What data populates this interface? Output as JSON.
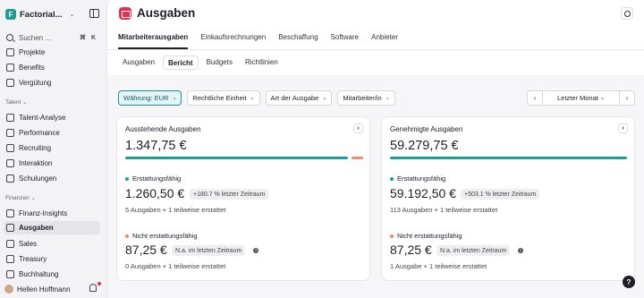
{
  "sidebar": {
    "brand": "Factorial...",
    "search": {
      "placeholder": "Suchen ...",
      "key1": "⌘",
      "key2": "K"
    },
    "items_top": [
      {
        "label": "Projekte",
        "icon": "projects-icon"
      },
      {
        "label": "Benefits",
        "icon": "benefits-icon"
      },
      {
        "label": "Vergütung",
        "icon": "compensation-icon"
      }
    ],
    "section_talent": "Talent",
    "items_talent": [
      {
        "label": "Talent-Analyse",
        "icon": "analytics-icon"
      },
      {
        "label": "Performance",
        "icon": "performance-icon"
      },
      {
        "label": "Recruiting",
        "icon": "recruiting-icon"
      },
      {
        "label": "Interaktion",
        "icon": "engagement-icon"
      },
      {
        "label": "Schulungen",
        "icon": "training-icon"
      }
    ],
    "section_finance": "Finanzen",
    "items_finance": [
      {
        "label": "Finanz-Insights",
        "icon": "insights-icon"
      },
      {
        "label": "Ausgaben",
        "icon": "expenses-icon",
        "active": true
      },
      {
        "label": "Sales",
        "icon": "sales-icon"
      },
      {
        "label": "Treasury",
        "icon": "treasury-icon"
      },
      {
        "label": "Buchhaltung",
        "icon": "accounting-icon"
      }
    ],
    "user": "Hellen Hoffmann"
  },
  "header": {
    "title": "Ausgaben",
    "tabs": [
      "Mitarbeiterausgaben",
      "Einkaufsrechnungen",
      "Beschaffung",
      "Software",
      "Anbieter"
    ],
    "active_tab": "Mitarbeiterausgaben",
    "subtabs": [
      "Ausgaben",
      "Bericht",
      "Budgets",
      "Richtlinien"
    ],
    "active_subtab": "Bericht"
  },
  "filters": {
    "currency": "Währung: EUR",
    "entity": "Rechtliche Einheit",
    "type": "Art der Ausgabe",
    "employee": "Mitarbeiter/in",
    "period": "Letzter Monat"
  },
  "cards": [
    {
      "title": "Ausstehende Ausgaben",
      "total": "1.347,75 €",
      "bar_primary_fraction": 0.936,
      "reimbursable_label": "Erstattungsfähig",
      "reimbursable_amount": "1.260,50 €",
      "reimbursable_change": "+180.7 % letzter Zeitraum",
      "reimbursable_detail": "5 Ausgaben + 1 teilweise erstattet",
      "non_reimbursable_label": "Nicht erstattungsfähig",
      "non_reimbursable_amount": "87,25 €",
      "non_reimbursable_change": "N.a. im letzten Zeitraum",
      "non_reimbursable_detail": "0 Ausgaben + 1 teilweise erstattet"
    },
    {
      "title": "Genehmigte Ausgaben",
      "total": "59.279,75 €",
      "bar_primary_fraction": 0.998,
      "reimbursable_label": "Erstattungsfähig",
      "reimbursable_amount": "59.192,50 €",
      "reimbursable_change": "+503.1 % letzter Zeitraum",
      "reimbursable_detail": "113 Ausgaben + 1 teilweise erstattet",
      "non_reimbursable_label": "Nicht erstattungsfähig",
      "non_reimbursable_amount": "87,25 €",
      "non_reimbursable_change": "N.a. im letzten Zeitraum",
      "non_reimbursable_detail": "1 Ausgabe + 1 teilweise erstattet"
    }
  ],
  "colors": {
    "teal": "#1f9d94",
    "salmon": "#f08a6b",
    "accent_red": "#e2334e"
  }
}
